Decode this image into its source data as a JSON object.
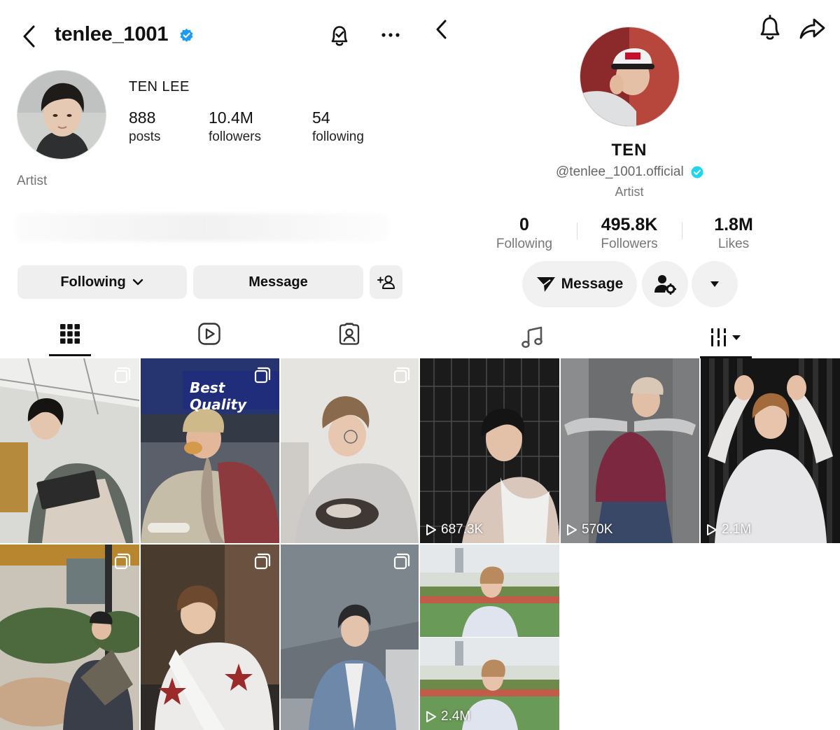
{
  "instagram": {
    "username": "tenlee_1001",
    "display_name": "TEN LEE",
    "stats": [
      {
        "num": "888",
        "label": "posts"
      },
      {
        "num": "10.4M",
        "label": "followers"
      },
      {
        "num": "54",
        "label": "following"
      }
    ],
    "category": "Artist",
    "buttons": {
      "following": "Following",
      "message": "Message"
    },
    "icons": {
      "back": "chevron-left-icon",
      "verified": "verified-badge-icon",
      "bell": "notification-bell-check-icon",
      "more": "more-horizontal-icon",
      "add_user": "add-user-icon"
    },
    "tabs": [
      "grid-icon",
      "reels-icon",
      "tagged-icon"
    ],
    "active_tab": 0,
    "posts": [
      {
        "type": "carousel",
        "caption_overlay": "",
        "palette": [
          "#dcdcd8",
          "#6a6f6a",
          "#2b2d2f"
        ]
      },
      {
        "type": "carousel",
        "caption_overlay": "Best Quality",
        "palette": [
          "#2a3a8a",
          "#c8b898",
          "#8a3030"
        ]
      },
      {
        "type": "carousel",
        "caption_overlay": "",
        "palette": [
          "#e8e6e4",
          "#b7b3ae",
          "#6b625b"
        ]
      },
      {
        "type": "carousel",
        "caption_overlay": "",
        "palette": [
          "#c9c5bd",
          "#46503c",
          "#3d3b3a"
        ]
      },
      {
        "type": "carousel",
        "caption_overlay": "",
        "palette": [
          "#4a3a2e",
          "#e7e3df",
          "#8f6f52"
        ]
      },
      {
        "type": "carousel",
        "caption_overlay": "",
        "palette": [
          "#6a7076",
          "#d2d4d6",
          "#6d88a8"
        ]
      }
    ]
  },
  "tiktok": {
    "name": "TEN",
    "handle": "@tenlee_1001.official",
    "bio": "Artist",
    "stats": [
      {
        "num": "0",
        "label": "Following"
      },
      {
        "num": "495.8K",
        "label": "Followers"
      },
      {
        "num": "1.8M",
        "label": "Likes"
      }
    ],
    "buttons": {
      "message": "Message"
    },
    "icons": {
      "back": "chevron-left-icon",
      "bell": "bell-icon",
      "share": "share-arrow-icon",
      "send": "send-icon",
      "user_settings": "user-settings-icon",
      "dropdown": "caret-down-icon"
    },
    "tabs": [
      "music-note-icon",
      "playlist-icon"
    ],
    "active_tab": 1,
    "videos": [
      {
        "views": "687.3K",
        "palette": [
          "#1d1d1d",
          "#3b3b3b",
          "#d6c4b8"
        ]
      },
      {
        "views": "570K",
        "palette": [
          "#6a6a6a",
          "#7c2840",
          "#3d4a66"
        ]
      },
      {
        "views": "2.1M",
        "palette": [
          "#1a1a1a",
          "#e8e8ea",
          "#a36a3c"
        ]
      },
      {
        "views": "2.4M",
        "palette": [
          "#d8dfd8",
          "#5f8a5a",
          "#c9cdd6"
        ]
      }
    ]
  },
  "colors": {
    "verified": "#1d9bf0",
    "tiktok_verified": "#20d5ec",
    "button_bg": "#efefef",
    "muted": "#737373"
  }
}
